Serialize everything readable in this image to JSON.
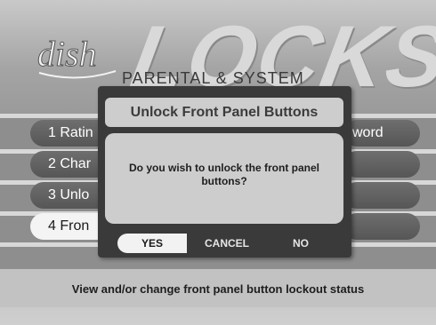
{
  "brand": {
    "logo_text": "dish",
    "screen_title": "LOCKS",
    "subtitle": "PARENTAL & SYSTEM"
  },
  "menu": {
    "items": [
      {
        "label": "1 Ratin"
      },
      {
        "label": "2 Char"
      },
      {
        "label": "3  Unlo"
      },
      {
        "label": "4 Fron",
        "selected": true
      }
    ],
    "right_fragment": "word"
  },
  "dialog": {
    "title": "Unlock Front Panel Buttons",
    "message": "Do you wish to unlock the front panel buttons?",
    "buttons": [
      {
        "label": "YES",
        "active": true
      },
      {
        "label": "CANCEL"
      },
      {
        "label": "NO"
      }
    ]
  },
  "help_text": "View and/or change front panel button lockout status",
  "colors": {
    "background": "#b0b0b0",
    "dialog": "#3a3a3a",
    "panel": "#cdcdcd",
    "pill": "#606060",
    "pill_selected": "#f4f4f4"
  }
}
